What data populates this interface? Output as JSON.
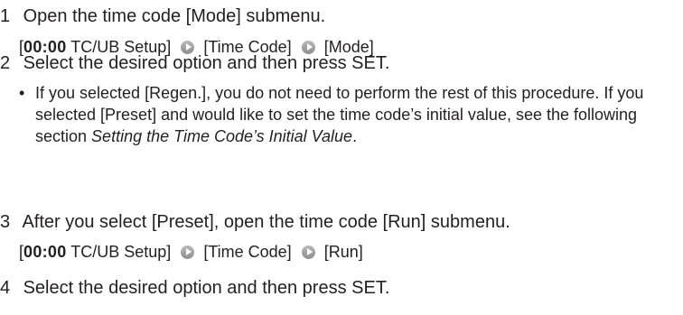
{
  "steps": [
    {
      "number": "1",
      "text": "Open the time code [Mode] submenu."
    },
    {
      "number": "2",
      "text": "Select the desired option and then press SET."
    },
    {
      "number": "3",
      "text": "After you select [Preset], open the time code [Run] submenu."
    },
    {
      "number": "4",
      "text": "Select the desired option and then press SET."
    }
  ],
  "menu_paths": {
    "mode": {
      "open_bracket": "[",
      "tc_icon": "00:00",
      "tc_label": " TC/UB Setup]",
      "item2": "[Time Code]",
      "item3": "[Mode]",
      "arrow_icon": "circle-arrow-right-icon"
    },
    "run": {
      "open_bracket": "[",
      "tc_icon": "00:00",
      "tc_label": " TC/UB Setup]",
      "item2": "[Time Code]",
      "item3": "[Run]",
      "arrow_icon": "circle-arrow-right-icon"
    }
  },
  "note": {
    "bullet": "•",
    "text_before": "If you selected [Regen.], you do not need to perform the rest of this procedure. If you selected [Preset] and would like to set the time code’s initial value, see the following section ",
    "link_text": "Setting the Time Code’s Initial Value",
    "text_after": "."
  },
  "colors": {
    "text": "#231f20",
    "arrow_circle": "#9a9a9a"
  }
}
